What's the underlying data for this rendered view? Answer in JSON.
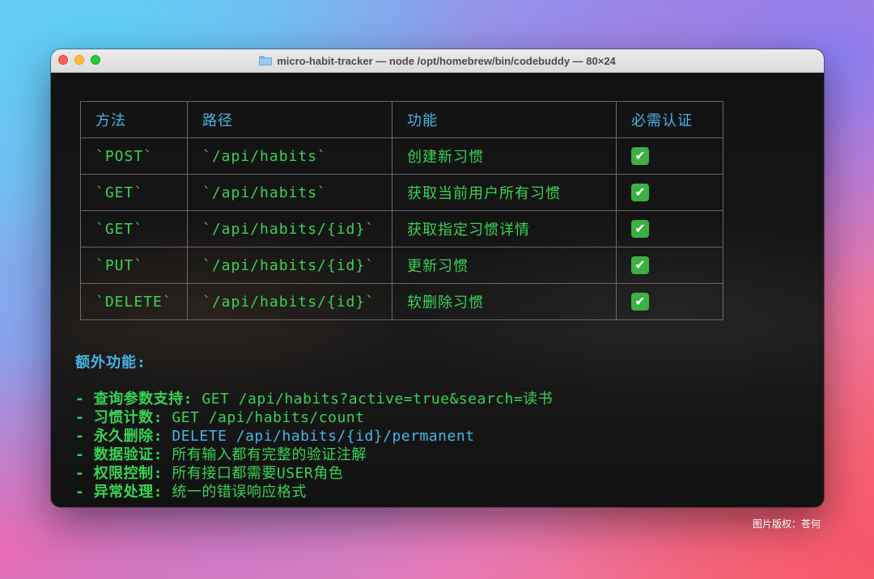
{
  "window": {
    "title": "micro-habit-tracker — node /opt/homebrew/bin/codebuddy — 80×24"
  },
  "table": {
    "headers": [
      "方法",
      "路径",
      "功能",
      "必需认证"
    ],
    "rows": [
      {
        "method": "`POST`",
        "path": "`/api/habits`",
        "function": "创建新习惯",
        "auth": "✔"
      },
      {
        "method": "`GET`",
        "path": "`/api/habits`",
        "function": "获取当前用户所有习惯",
        "auth": "✔"
      },
      {
        "method": "`GET`",
        "path": "`/api/habits/{id}`",
        "function": "获取指定习惯详情",
        "auth": "✔"
      },
      {
        "method": "`PUT`",
        "path": "`/api/habits/{id}`",
        "function": "更新习惯",
        "auth": "✔"
      },
      {
        "method": "`DELETE`",
        "path": "`/api/habits/{id}`",
        "function": "软删除习惯",
        "auth": "✔"
      }
    ]
  },
  "extra": {
    "heading": "额外功能:",
    "bullet": "-",
    "items": [
      {
        "label": "查询参数支持:",
        "desc": "GET /api/habits?active=true&search=读书"
      },
      {
        "label": "习惯计数:",
        "desc": "GET /api/habits/count"
      },
      {
        "label": "永久删除:",
        "desc": "DELETE /api/habits/{id}/permanent"
      },
      {
        "label": "数据验证:",
        "desc": "所有输入都有完整的验证注解"
      },
      {
        "label": "权限控制:",
        "desc": "所有接口都需要USER角色"
      },
      {
        "label": "异常处理:",
        "desc": "统一的错误响应格式"
      }
    ]
  },
  "credit": "图片版权：苍何",
  "colors": {
    "green": "#39d353",
    "blue": "#45b5e6",
    "check_bg": "#3cb043"
  },
  "icons": {
    "title_icon": "folder-icon",
    "check": "check-mark-icon"
  }
}
